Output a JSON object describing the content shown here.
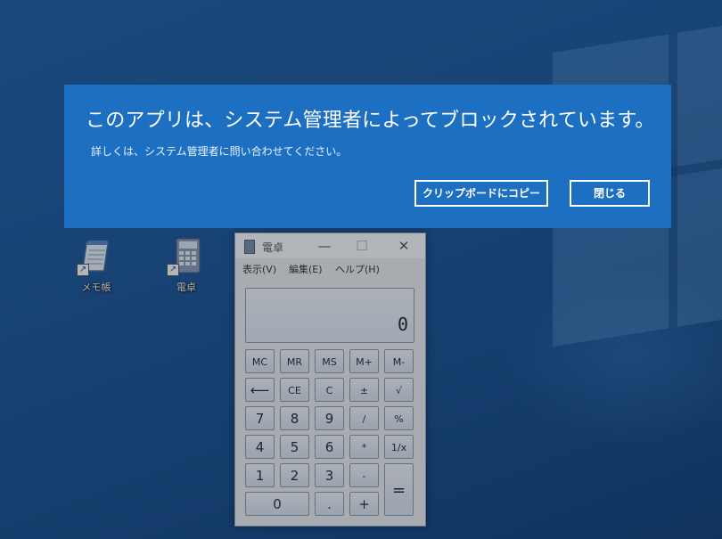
{
  "desktop": {
    "icons": [
      {
        "label": "メモ帳",
        "icon": "notepad-icon"
      },
      {
        "label": "電卓",
        "icon": "calculator-icon"
      }
    ]
  },
  "calculator": {
    "title": "電卓",
    "controls": {
      "minimize": "—",
      "maximize": "☐",
      "close": "✕"
    },
    "menu": [
      "表示(V)",
      "編集(E)",
      "ヘルプ(H)"
    ],
    "display_value": "0",
    "keys": {
      "mc": "MC",
      "mr": "MR",
      "ms": "MS",
      "mplus": "M+",
      "mminus": "M-",
      "back": "⟵",
      "ce": "CE",
      "c": "C",
      "plusminus": "±",
      "sqrt": "√",
      "k7": "7",
      "k8": "8",
      "k9": "9",
      "div": "/",
      "pct": "%",
      "k4": "4",
      "k5": "5",
      "k6": "6",
      "mul": "*",
      "recip": "1/x",
      "k1": "1",
      "k2": "2",
      "k3": "3",
      "sub": "-",
      "eq": "=",
      "k0": "0",
      "dot": ".",
      "add": "+"
    }
  },
  "dialog": {
    "heading": "このアプリは、システム管理者によってブロックされています。",
    "body": "詳しくは、システム管理者に問い合わせてください。",
    "copy_label": "クリップボードにコピー",
    "close_label": "閉じる"
  },
  "colors": {
    "dialog_bg": "#1d6fc2",
    "desktop_bg": "#1a5699"
  }
}
